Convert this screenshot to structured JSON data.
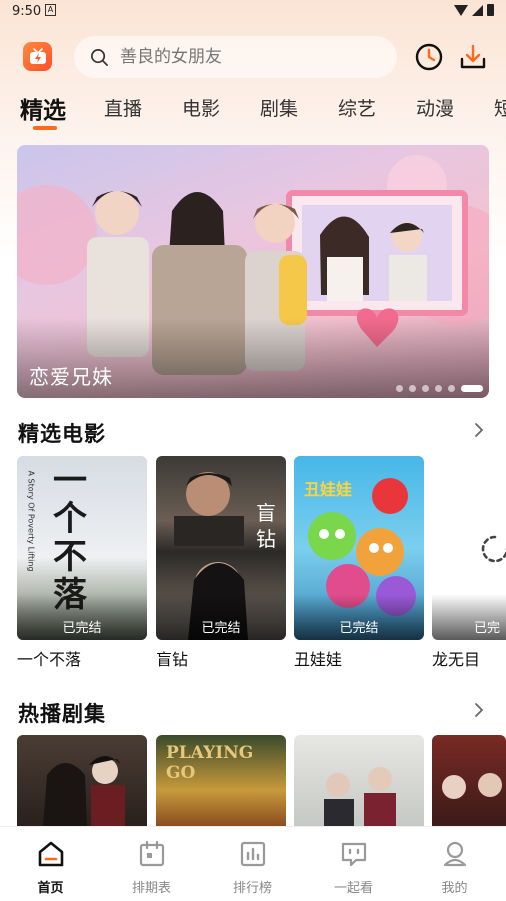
{
  "status_bar": {
    "time": "9:50",
    "notification_icon": "A"
  },
  "header": {
    "logo_icon": "app-logo-icon",
    "search_placeholder": "善良的女朋友",
    "history_icon": "clock-icon",
    "download_icon": "download-icon"
  },
  "tabs": [
    {
      "label": "精选",
      "active": true
    },
    {
      "label": "直播"
    },
    {
      "label": "电影"
    },
    {
      "label": "剧集"
    },
    {
      "label": "综艺"
    },
    {
      "label": "动漫"
    },
    {
      "label": "短"
    }
  ],
  "banner": {
    "title": "恋爱兄妹",
    "dot_count": 6,
    "active_dot": 6
  },
  "movies_section": {
    "title": "精选电影",
    "items": [
      {
        "title": "一个不落",
        "badge": "已完结",
        "poster_text": "一个不落",
        "poster_sub": "A Story Of Poverty Lifting"
      },
      {
        "title": "盲钻",
        "badge": "已完结",
        "poster_text": "盲钻"
      },
      {
        "title": "丑娃娃",
        "badge": "已完结",
        "poster_text": "丑娃娃"
      },
      {
        "title": "龙无目",
        "badge": "已完"
      }
    ]
  },
  "series_section": {
    "title": "热播剧集",
    "first_poster_text": "PLAYING GO"
  },
  "bottom_nav": [
    {
      "label": "首页",
      "icon": "home-icon",
      "active": true
    },
    {
      "label": "排期表",
      "icon": "calendar-icon"
    },
    {
      "label": "排行榜",
      "icon": "chart-icon"
    },
    {
      "label": "一起看",
      "icon": "chat-icon"
    },
    {
      "label": "我的",
      "icon": "user-icon"
    }
  ],
  "colors": {
    "accent": "#ff6a1a",
    "text": "#111111",
    "muted": "#888888"
  }
}
